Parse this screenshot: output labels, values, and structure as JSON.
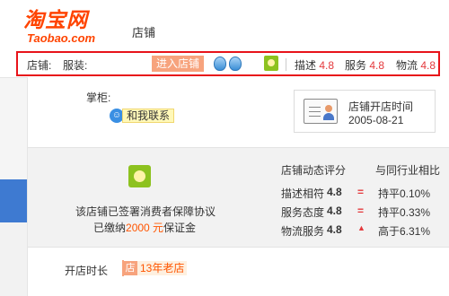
{
  "header": {
    "logo_cn": "淘宝网",
    "logo_en": "Taobao.com",
    "nav_label": "店铺"
  },
  "shop_strip": {
    "shop_label": "店铺:",
    "category": "服装:",
    "enter_button": "进入店铺",
    "ratings": [
      {
        "label": "描述",
        "score": "4.8"
      },
      {
        "label": "服务",
        "score": "4.8"
      },
      {
        "label": "物流",
        "score": "4.8"
      }
    ]
  },
  "shopkeeper": {
    "label": "掌柜:",
    "contact_button": "和我联系"
  },
  "open_info": {
    "title": "店铺开店时间",
    "date": "2005-08-21"
  },
  "guarantee": {
    "agreement": "该店铺已签署消费者保障协议",
    "deposit_prefix": "已缴纳",
    "deposit_amount": "2000 元",
    "deposit_suffix": "保证金"
  },
  "dynamic_scores": {
    "title": "店铺动态评分",
    "compare_title": "与同行业相比",
    "rows": [
      {
        "label": "描述相符",
        "score": "4.8",
        "mark": "=",
        "compare": "持平0.10%"
      },
      {
        "label": "服务态度",
        "score": "4.8",
        "mark": "=",
        "compare": "持平0.33%"
      },
      {
        "label": "物流服务",
        "score": "4.8",
        "mark": "▲",
        "compare": "高于6.31%"
      }
    ]
  },
  "shop_age": {
    "label": "开店时长",
    "icon_char": "店",
    "value": "13年老店"
  },
  "colors": {
    "brand": "#ff4400",
    "highlight_border": "#e8131a",
    "score_red": "#e4393c",
    "enter_button_bg": "#f7a37d"
  }
}
